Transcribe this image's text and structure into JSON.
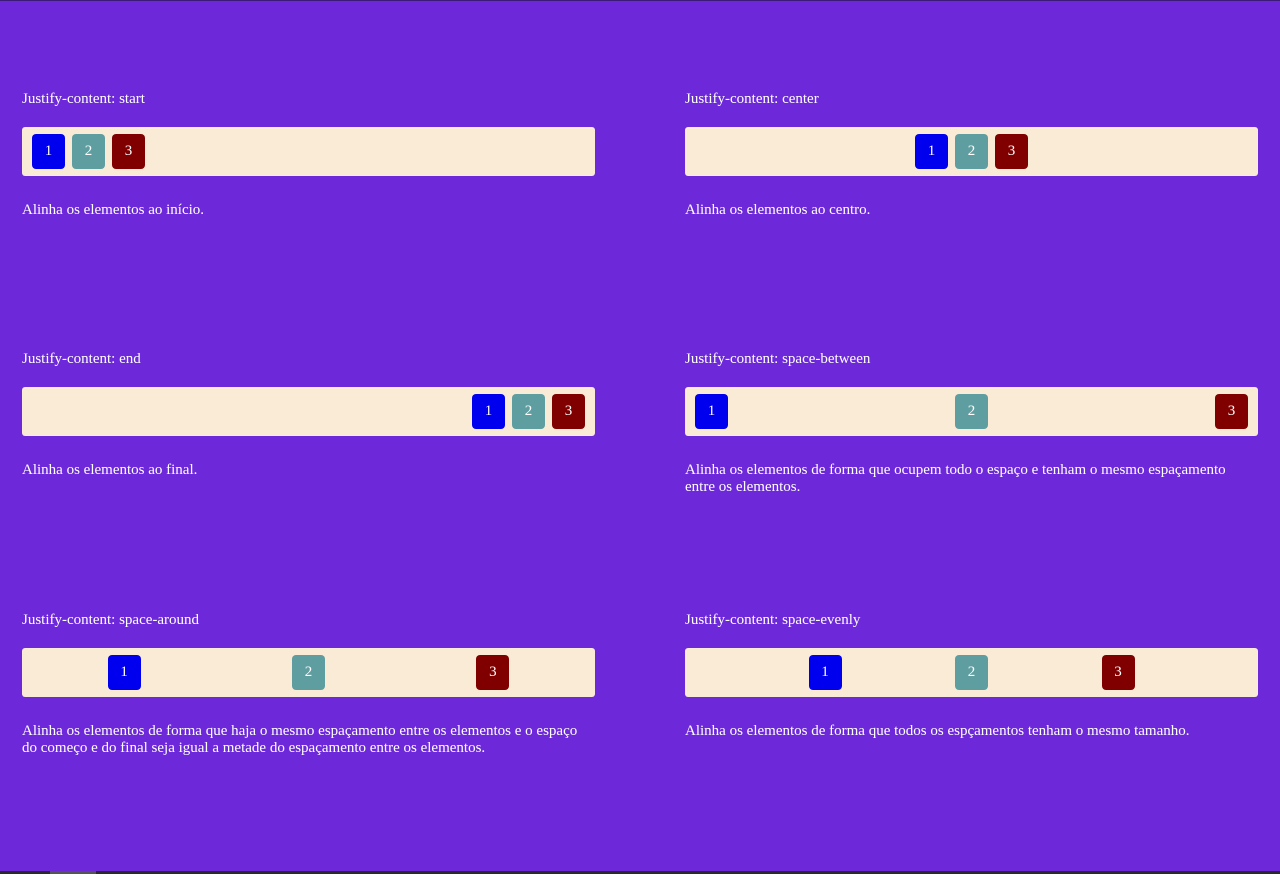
{
  "sections": [
    {
      "title": "Justify-content: start",
      "items": [
        "1",
        "2",
        "3"
      ],
      "description": "Alinha os elementos ao início."
    },
    {
      "title": "Justify-content: center",
      "items": [
        "1",
        "2",
        "3"
      ],
      "description": "Alinha os elementos ao centro."
    },
    {
      "title": "Justify-content: end",
      "items": [
        "1",
        "2",
        "3"
      ],
      "description": "Alinha os elementos ao final."
    },
    {
      "title": "Justify-content: space-between",
      "items": [
        "1",
        "2",
        "3"
      ],
      "description": "Alinha os elementos de forma que ocupem todo o espaço e tenham o mesmo espaçamento entre os elementos."
    },
    {
      "title": "Justify-content: space-around",
      "items": [
        "1",
        "2",
        "3"
      ],
      "description": "Alinha os elementos de forma que haja o mesmo espaçamento entre os elementos e o espaço do começo e do final seja igual a metade do espaçamento entre os elementos."
    },
    {
      "title": "Justify-content: space-evenly",
      "items": [
        "1",
        "2",
        "3"
      ],
      "description": "Alinha os elementos de forma que todos os espçamentos tenham o mesmo tamanho."
    }
  ],
  "colors": {
    "background": "#6d28d9",
    "container": "#faebd7",
    "item_1": "#0000ee",
    "item_2": "#5f9ea0",
    "item_3": "#800000",
    "text": "#ffffff"
  }
}
